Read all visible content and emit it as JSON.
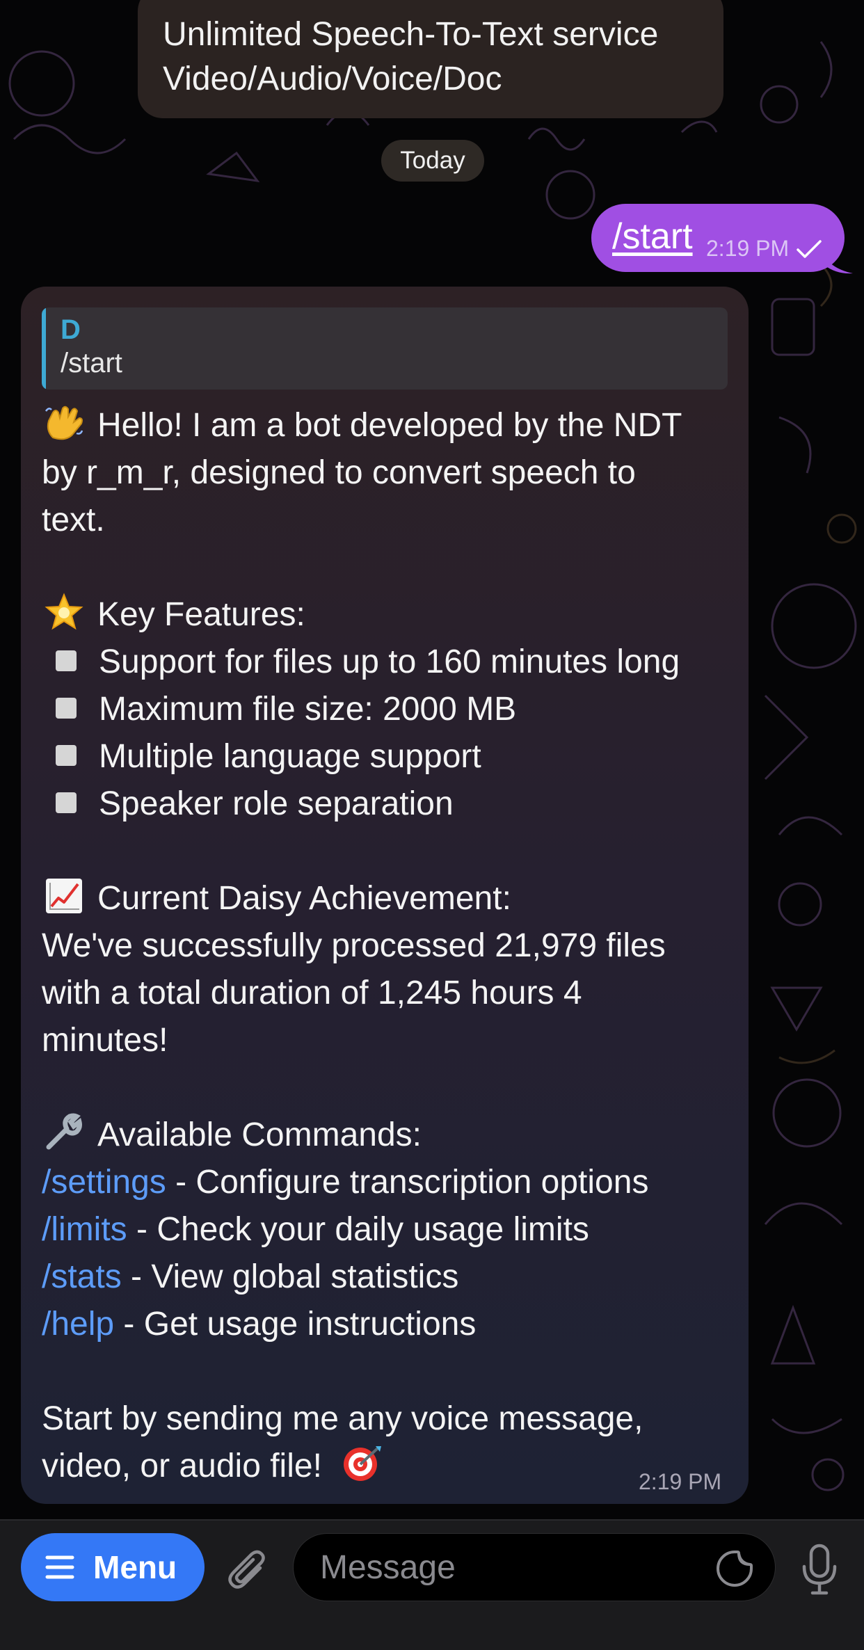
{
  "previous_message": {
    "line1": "Unlimited Speech-To-Text service",
    "line2": "Video/Audio/Voice/Doc"
  },
  "date_separator": "Today",
  "outgoing": {
    "text": "/start",
    "time": "2:19 PM",
    "status_icon": "single-check"
  },
  "bot_message": {
    "reply": {
      "author": "D",
      "text": "/start"
    },
    "intro_line1": "Hello! I am a bot developed by the NDT",
    "intro_line2": "by r_m_r, designed to convert speech to",
    "intro_line3": "text.",
    "features_title": "Key Features:",
    "features": [
      "Support for files up to 160 minutes long",
      "Maximum file size: 2000 MB",
      "Multiple language support",
      "Speaker role separation"
    ],
    "achievement_title": "Current Daisy Achievement:",
    "achievement_line1": "We've successfully processed 21,979 files",
    "achievement_line2": "with a total duration of 1,245 hours 4",
    "achievement_line3": "minutes!",
    "commands_title": "Available Commands:",
    "commands": [
      {
        "cmd": "/settings",
        "desc": " - Configure transcription options"
      },
      {
        "cmd": "/limits",
        "desc": " - Check your daily usage limits"
      },
      {
        "cmd": "/stats",
        "desc": " - View global statistics"
      },
      {
        "cmd": "/help",
        "desc": " - Get usage instructions"
      }
    ],
    "outro_line1": "Start by sending me any voice message,",
    "outro_line2": "video, or audio file!",
    "time": "2:19 PM",
    "emoji_names": [
      "waving-hand",
      "glowing-star",
      "chart-increasing",
      "wrench",
      "direct-hit"
    ]
  },
  "input_bar": {
    "menu_label": "Menu",
    "placeholder": "Message",
    "icons": [
      "menu-icon",
      "paperclip-icon",
      "sticker-icon",
      "microphone-icon"
    ]
  },
  "colors": {
    "outgoing_bubble": "#a04fe3",
    "link": "#5d9cf8",
    "menu_button": "#3478f6",
    "reply_accent": "#3ea9d4"
  }
}
